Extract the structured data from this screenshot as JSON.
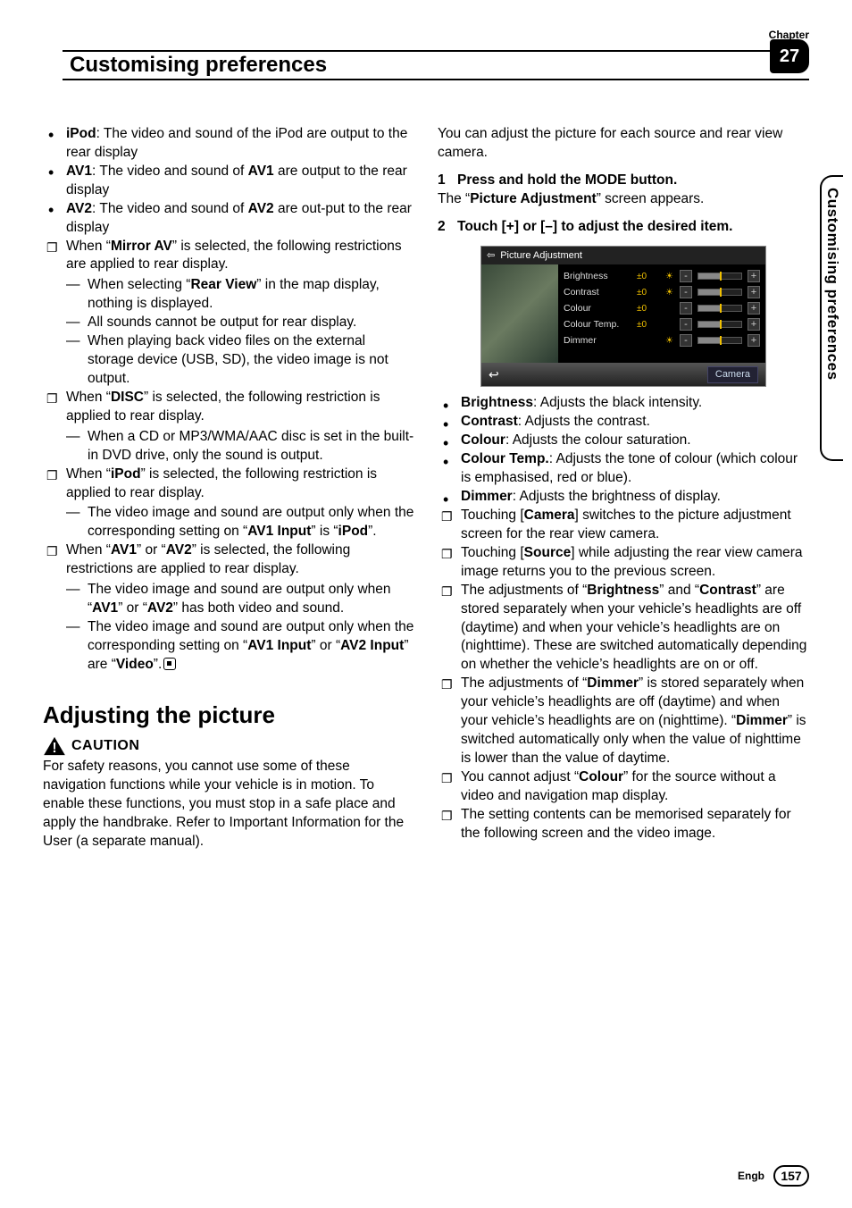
{
  "header": {
    "chapter_label": "Chapter",
    "title": "Customising preferences",
    "chapter_number": "27"
  },
  "side_tab": "Customising preferences",
  "left": {
    "b1": {
      "ipod_b": "iPod",
      "ipod": ": The video and sound of the iPod are output to the rear display"
    },
    "b2": {
      "av1_b": "AV1",
      "mid": ": The video and sound of ",
      "av1_b2": "AV1",
      "end": " are output to the rear display"
    },
    "b3": {
      "av2_b": "AV2",
      "mid": ": The video and sound of ",
      "av2_b2": "AV2",
      "end": " are out-put to the rear display"
    },
    "n1": {
      "p1": "When “",
      "b": "Mirror AV",
      "p2": "” is selected, the following restrictions are applied to rear display."
    },
    "n1s1": {
      "p1": "When selecting “",
      "b": "Rear View",
      "p2": "” in the map display, nothing is displayed."
    },
    "n1s2": "All sounds cannot be output for rear display.",
    "n1s3": "When playing back video files on the external storage device (USB, SD), the video image is not output.",
    "n2": {
      "p1": "When “",
      "b": "DISC",
      "p2": "” is selected, the following restriction is applied to rear display."
    },
    "n2s1": "When a CD or MP3/WMA/AAC disc is set in the built-in DVD drive, only the sound is output.",
    "n3": {
      "p1": "When “",
      "b": "iPod",
      "p2": "” is selected, the following restriction is applied to rear display."
    },
    "n3s1": {
      "p1": "The video image and sound are output only when the corresponding setting on “",
      "b": "AV1 Input",
      "p2": "” is “",
      "b2": "iPod",
      "p3": "”."
    },
    "n4": {
      "p1": "When “",
      "b1": "AV1",
      "p2": "” or “",
      "b2": "AV2",
      "p3": "” is selected, the following restrictions are applied to rear display."
    },
    "n4s1": {
      "p1": "The video image and sound are output only when “",
      "b1": "AV1",
      "p2": "” or “",
      "b2": "AV2",
      "p3": "” has both video and sound."
    },
    "n4s2": {
      "p1": "The video image and sound are output only when the corresponding setting on “",
      "b1": "AV1 Input",
      "p2": "” or “",
      "b2": "AV2 Input",
      "p3": "” are “",
      "b3": "Video",
      "p4": "”."
    },
    "h2": "Adjusting the picture",
    "caution": "CAUTION",
    "caution_body": "For safety reasons, you cannot use some of these navigation functions while your vehicle is in motion. To enable these functions, you must stop in a safe place and apply the handbrake. Refer to Important Information for the User (a separate manual)."
  },
  "right": {
    "intro": "You can adjust the picture for each source and rear view camera.",
    "s1_num": "1",
    "s1": "Press and hold the MODE button.",
    "s1_sub_p1": "The “",
    "s1_sub_b": "Picture Adjustment",
    "s1_sub_p2": "” screen appears.",
    "s2_num": "2",
    "s2": "Touch [+] or [–] to adjust the desired item.",
    "shot": {
      "title": "Picture Adjustment",
      "rows": [
        {
          "label": "Brightness",
          "val": "±0",
          "sun": "☀",
          "minus": "-",
          "plus": "+"
        },
        {
          "label": "Contrast",
          "val": "±0",
          "sun": "☀",
          "minus": "-",
          "plus": "+"
        },
        {
          "label": "Colour",
          "val": "±0",
          "sun": "",
          "minus": "-",
          "plus": "+"
        },
        {
          "label": "Colour Temp.",
          "val": "±0",
          "sun": "",
          "minus": "-",
          "plus": "+"
        },
        {
          "label": "Dimmer",
          "val": "",
          "sun": "☀",
          "minus": "-",
          "plus": "+"
        }
      ],
      "back": "↩",
      "camera": "Camera"
    },
    "bl1": {
      "b": "Brightness",
      "t": ": Adjusts the black intensity."
    },
    "bl2": {
      "b": "Contrast",
      "t": ": Adjusts the contrast."
    },
    "bl3": {
      "b": "Colour",
      "t": ": Adjusts the colour saturation."
    },
    "bl4": {
      "b": "Colour Temp.",
      "t": ": Adjusts the tone of colour (which colour is emphasised, red or blue)."
    },
    "bl5": {
      "b": "Dimmer",
      "t": ": Adjusts the brightness of display."
    },
    "nq1": {
      "p1": "Touching [",
      "b": "Camera",
      "p2": "] switches to the picture adjustment screen for the rear view camera."
    },
    "nq2": {
      "p1": "Touching [",
      "b": "Source",
      "p2": "] while adjusting the rear view camera image returns you to the previous screen."
    },
    "nq3": {
      "p1": "The adjustments of “",
      "b1": "Brightness",
      "p2": "” and “",
      "b2": "Contrast",
      "p3": "” are stored separately when your vehicle’s headlights are off (daytime) and when your vehicle’s headlights are on (nighttime). These are switched automatically depending on whether the vehicle’s headlights are on or off."
    },
    "nq4": {
      "p1": "The adjustments of “",
      "b1": "Dimmer",
      "p2": "” is stored separately when your vehicle’s headlights are off (daytime) and when your vehicle’s headlights are on (nighttime). “",
      "b2": "Dimmer",
      "p3": "” is switched automatically only when the value of nighttime is lower than the value of daytime."
    },
    "nq5": {
      "p1": "You cannot adjust “",
      "b": "Colour",
      "p2": "” for the source without a video and navigation map display."
    },
    "nq6": "The setting contents can be memorised separately for the following screen and the video image."
  },
  "footer": {
    "lang": "Engb",
    "page": "157"
  }
}
